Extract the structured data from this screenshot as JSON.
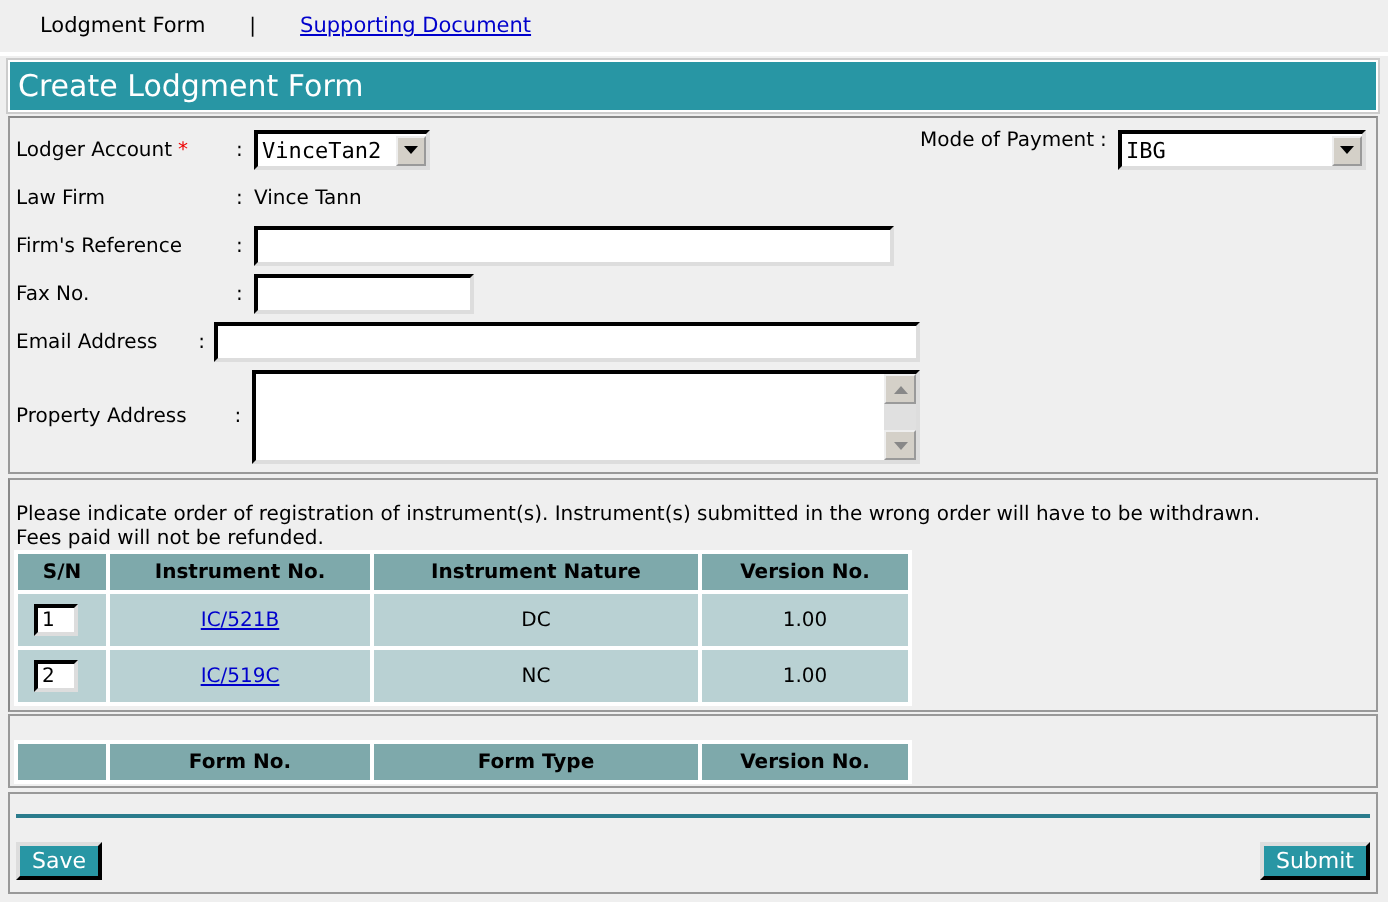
{
  "tabs": [
    {
      "label": "Lodgment Form",
      "selected": true
    },
    {
      "label": "Supporting Document",
      "selected": false
    }
  ],
  "tab_separator": "|",
  "title": "Create Lodgment Form",
  "fields": [
    {
      "kind": "select",
      "label": "Lodger Account",
      "required": "*",
      "colon": ":",
      "value": "VinceTan2"
    },
    {
      "kind": "text",
      "label": "Law Firm",
      "colon": ":",
      "value": "Vince Tann"
    },
    {
      "kind": "input",
      "label": "Firm's Reference",
      "colon": ":"
    },
    {
      "kind": "input",
      "label": "Fax No.",
      "colon": ":"
    },
    {
      "kind": "input",
      "label": "Email Address",
      "colon": ":"
    },
    {
      "kind": "textarea",
      "label": "Property Address",
      "colon": ":"
    }
  ],
  "payment": {
    "label": "Mode of Payment",
    "colon": ":",
    "value": "IBG"
  },
  "instructions": "Please indicate order of registration of instrument(s). Instrument(s) submitted in the wrong order will have to be withdrawn. Fees paid will not be refunded.",
  "instruments": {
    "columns": [
      "S/N",
      "Instrument No.",
      "Instrument Nature",
      "Version No."
    ],
    "rows": [
      {
        "sn": "1",
        "number": "IC/521B",
        "nature": "DC",
        "version": "1.00"
      },
      {
        "sn": "2",
        "number": "IC/519C",
        "nature": "NC",
        "version": "1.00"
      }
    ]
  },
  "forms": {
    "columns": [
      "Form No.",
      "Form Type",
      "Version No."
    ]
  },
  "buttons": [
    "Save",
    "Submit"
  ]
}
